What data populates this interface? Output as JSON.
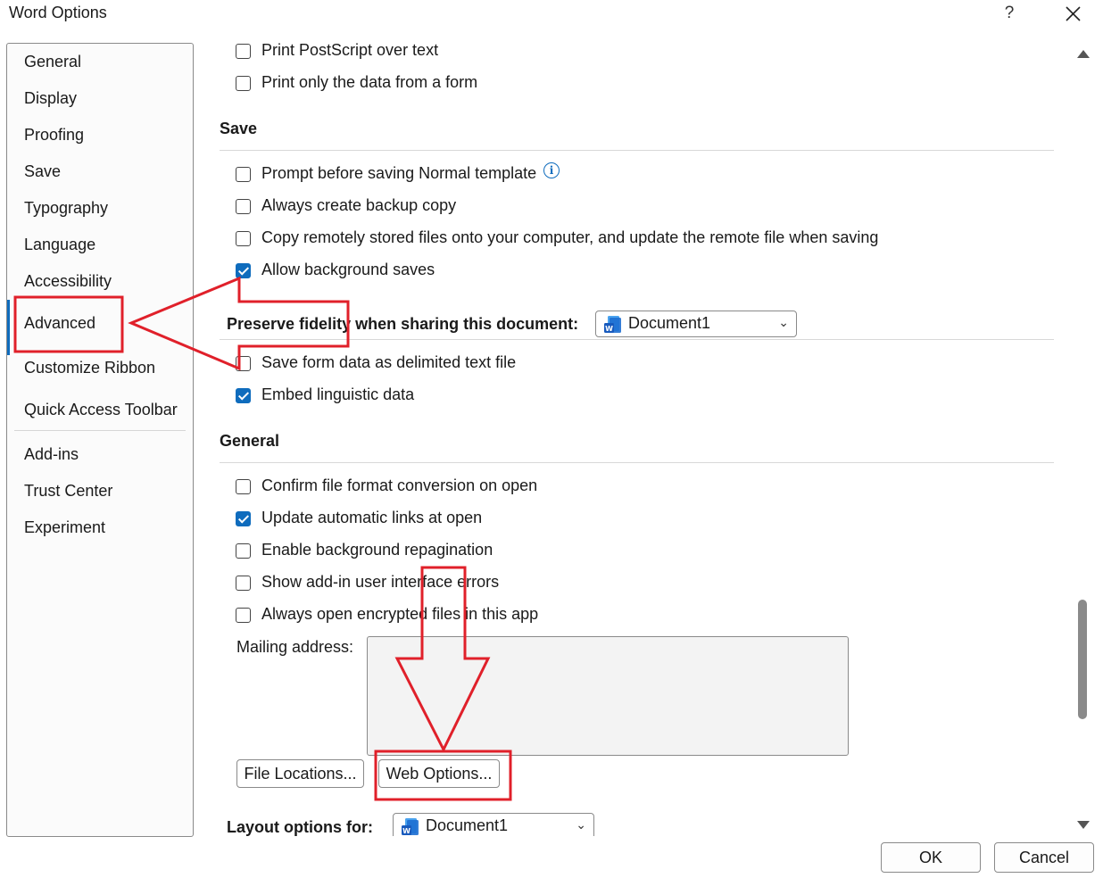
{
  "window": {
    "title": "Word Options",
    "help_label": "?"
  },
  "nav": {
    "items": [
      {
        "label": "General"
      },
      {
        "label": "Display"
      },
      {
        "label": "Proofing"
      },
      {
        "label": "Save"
      },
      {
        "label": "Typography"
      },
      {
        "label": "Language"
      },
      {
        "label": "Accessibility"
      },
      {
        "label": "Advanced",
        "selected": true
      },
      {
        "label": "Customize Ribbon"
      },
      {
        "label": "Quick Access Toolbar"
      },
      {
        "label": "Add-ins"
      },
      {
        "label": "Trust Center"
      },
      {
        "label": "Experiment"
      }
    ]
  },
  "print": {
    "postscript": {
      "label": "Print PostScript over text",
      "checked": false
    },
    "form_data_only": {
      "label": "Print only the data from a form",
      "checked": false
    }
  },
  "save": {
    "heading": "Save",
    "prompt_normal": {
      "label": "Prompt before saving Normal template",
      "checked": false
    },
    "backup_copy": {
      "label": "Always create backup copy",
      "checked": false
    },
    "copy_remote": {
      "label": "Copy remotely stored files onto your computer, and update the remote file when saving",
      "checked": false
    },
    "background_saves": {
      "label": "Allow background saves",
      "checked": true
    }
  },
  "fidelity": {
    "label": "Preserve fidelity when sharing this document:",
    "document": "Document1",
    "delimited_text": {
      "label": "Save form data as delimited text file",
      "checked": false
    },
    "embed_linguistic": {
      "label": "Embed linguistic data",
      "checked": true
    }
  },
  "general": {
    "heading": "General",
    "confirm_conversion": {
      "label": "Confirm file format conversion on open",
      "checked": false
    },
    "update_links": {
      "label": "Update automatic links at open",
      "checked": true
    },
    "background_repagination": {
      "label": "Enable background repagination",
      "checked": false
    },
    "addin_errors": {
      "label": "Show add-in user interface errors",
      "checked": false
    },
    "encrypted_files": {
      "label": "Always open encrypted files in this app",
      "checked": false
    },
    "mailing_address_label": "Mailing address:",
    "mailing_address_value": "",
    "file_locations_button": "File Locations...",
    "web_options_button": "Web Options..."
  },
  "layout": {
    "label": "Layout options for:",
    "document": "Document1"
  },
  "footer": {
    "ok": "OK",
    "cancel": "Cancel"
  },
  "colors": {
    "accent": "#0f6cbd",
    "annotation": "#e0202a"
  }
}
